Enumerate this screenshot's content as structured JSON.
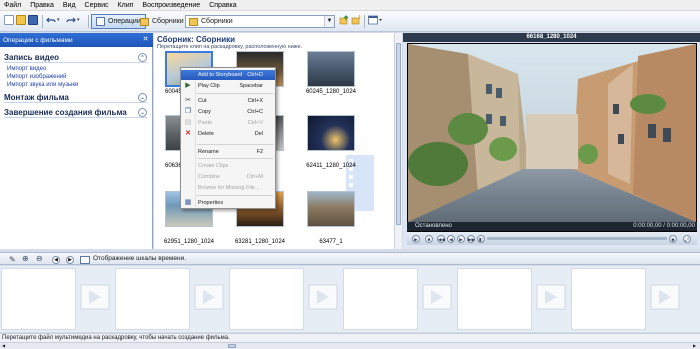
{
  "menu": [
    "Файл",
    "Правка",
    "Вид",
    "Сервис",
    "Клип",
    "Воспроизведение",
    "Справка"
  ],
  "toolbar": {
    "operations_label": "Операции",
    "collections_label": "Сборники",
    "collection_select": "Сборники"
  },
  "tasks": {
    "header": "Операции с фильмами",
    "sections": [
      {
        "title": "Запись видео",
        "links": [
          "Импорт видео",
          "Импорт изображений",
          "Импорт звука или музыки"
        ]
      },
      {
        "title": "Монтаж фильма",
        "links": []
      },
      {
        "title": "Завершение создания фильма",
        "links": []
      }
    ]
  },
  "collection": {
    "title": "Сборник: Сборники",
    "subtitle": "Перетащите клип на раскадровку, расположенную ниже.",
    "clips": [
      {
        "label": "60045"
      },
      {
        "label": ""
      },
      {
        "label": "60245_1280_1024"
      },
      {
        "label": "60636"
      },
      {
        "label": ""
      },
      {
        "label": "62411_1280_1024"
      },
      {
        "label": "62951_1280_1024"
      },
      {
        "label": "63281_1280_1024"
      },
      {
        "label": "63477_1"
      }
    ]
  },
  "context_menu": {
    "items": [
      {
        "label": "Add to Storyboard",
        "shortcut": "Ctrl+D",
        "state": "highlighted"
      },
      {
        "label": "Play Clip",
        "shortcut": "Spacebar",
        "state": "enabled"
      },
      {
        "label": "Cut",
        "shortcut": "Ctrl+X",
        "state": "enabled"
      },
      {
        "label": "Copy",
        "shortcut": "Ctrl+C",
        "state": "enabled"
      },
      {
        "label": "Paste",
        "shortcut": "Ctrl+V",
        "state": "disabled"
      },
      {
        "label": "Delete",
        "shortcut": "Del",
        "state": "enabled"
      },
      {
        "label": "Rename",
        "shortcut": "F2",
        "state": "enabled"
      },
      {
        "label": "Create Clips",
        "shortcut": "",
        "state": "disabled"
      },
      {
        "label": "Combine",
        "shortcut": "Ctrl+M",
        "state": "disabled"
      },
      {
        "label": "Browse for Missing File...",
        "shortcut": "",
        "state": "disabled"
      },
      {
        "label": "Properties",
        "shortcut": "",
        "state": "enabled"
      }
    ]
  },
  "player": {
    "title": "66168_1280_1024",
    "status": "Остановлено",
    "time": "0:00:00,00 / 0:00:00,00"
  },
  "storyboard": {
    "show_timeline_label": "Отображение шкалы времени.",
    "hint": "Перетащите файл мультимедиа на раскадровку, чтобы начать создание фильма.",
    "cell_count": 6
  },
  "colors": {
    "accent": "#2659bd",
    "task_header": "#1f55b7"
  }
}
